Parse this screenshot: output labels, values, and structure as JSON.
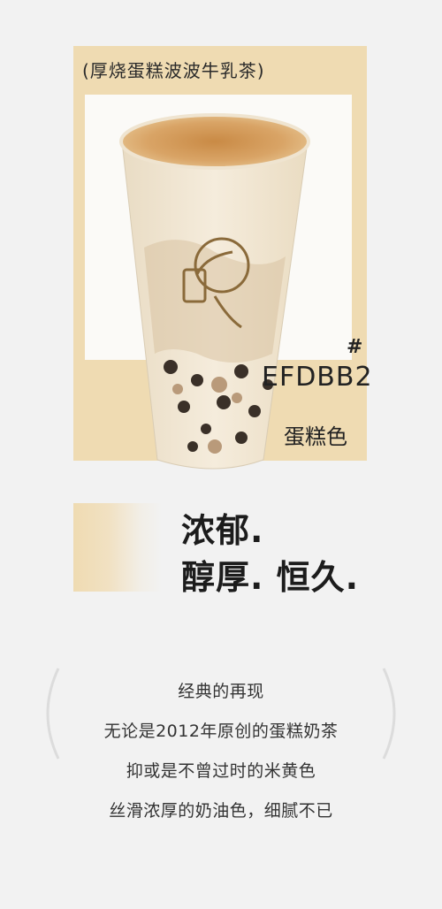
{
  "card": {
    "product_name": "(厚烧蛋糕波波牛乳茶)",
    "hash": "#",
    "hex_code": "EFDBB2",
    "color_name": "蛋糕色",
    "swatch_color": "#efdbb2"
  },
  "tagline": {
    "line1": "浓郁.",
    "line2": "醇厚.  恒久."
  },
  "description": {
    "lines": [
      "经典的再现",
      "无论是2012年原创的蛋糕奶茶",
      "抑或是不曾过时的米黄色",
      "丝滑浓厚的奶油色，细腻不已"
    ]
  }
}
